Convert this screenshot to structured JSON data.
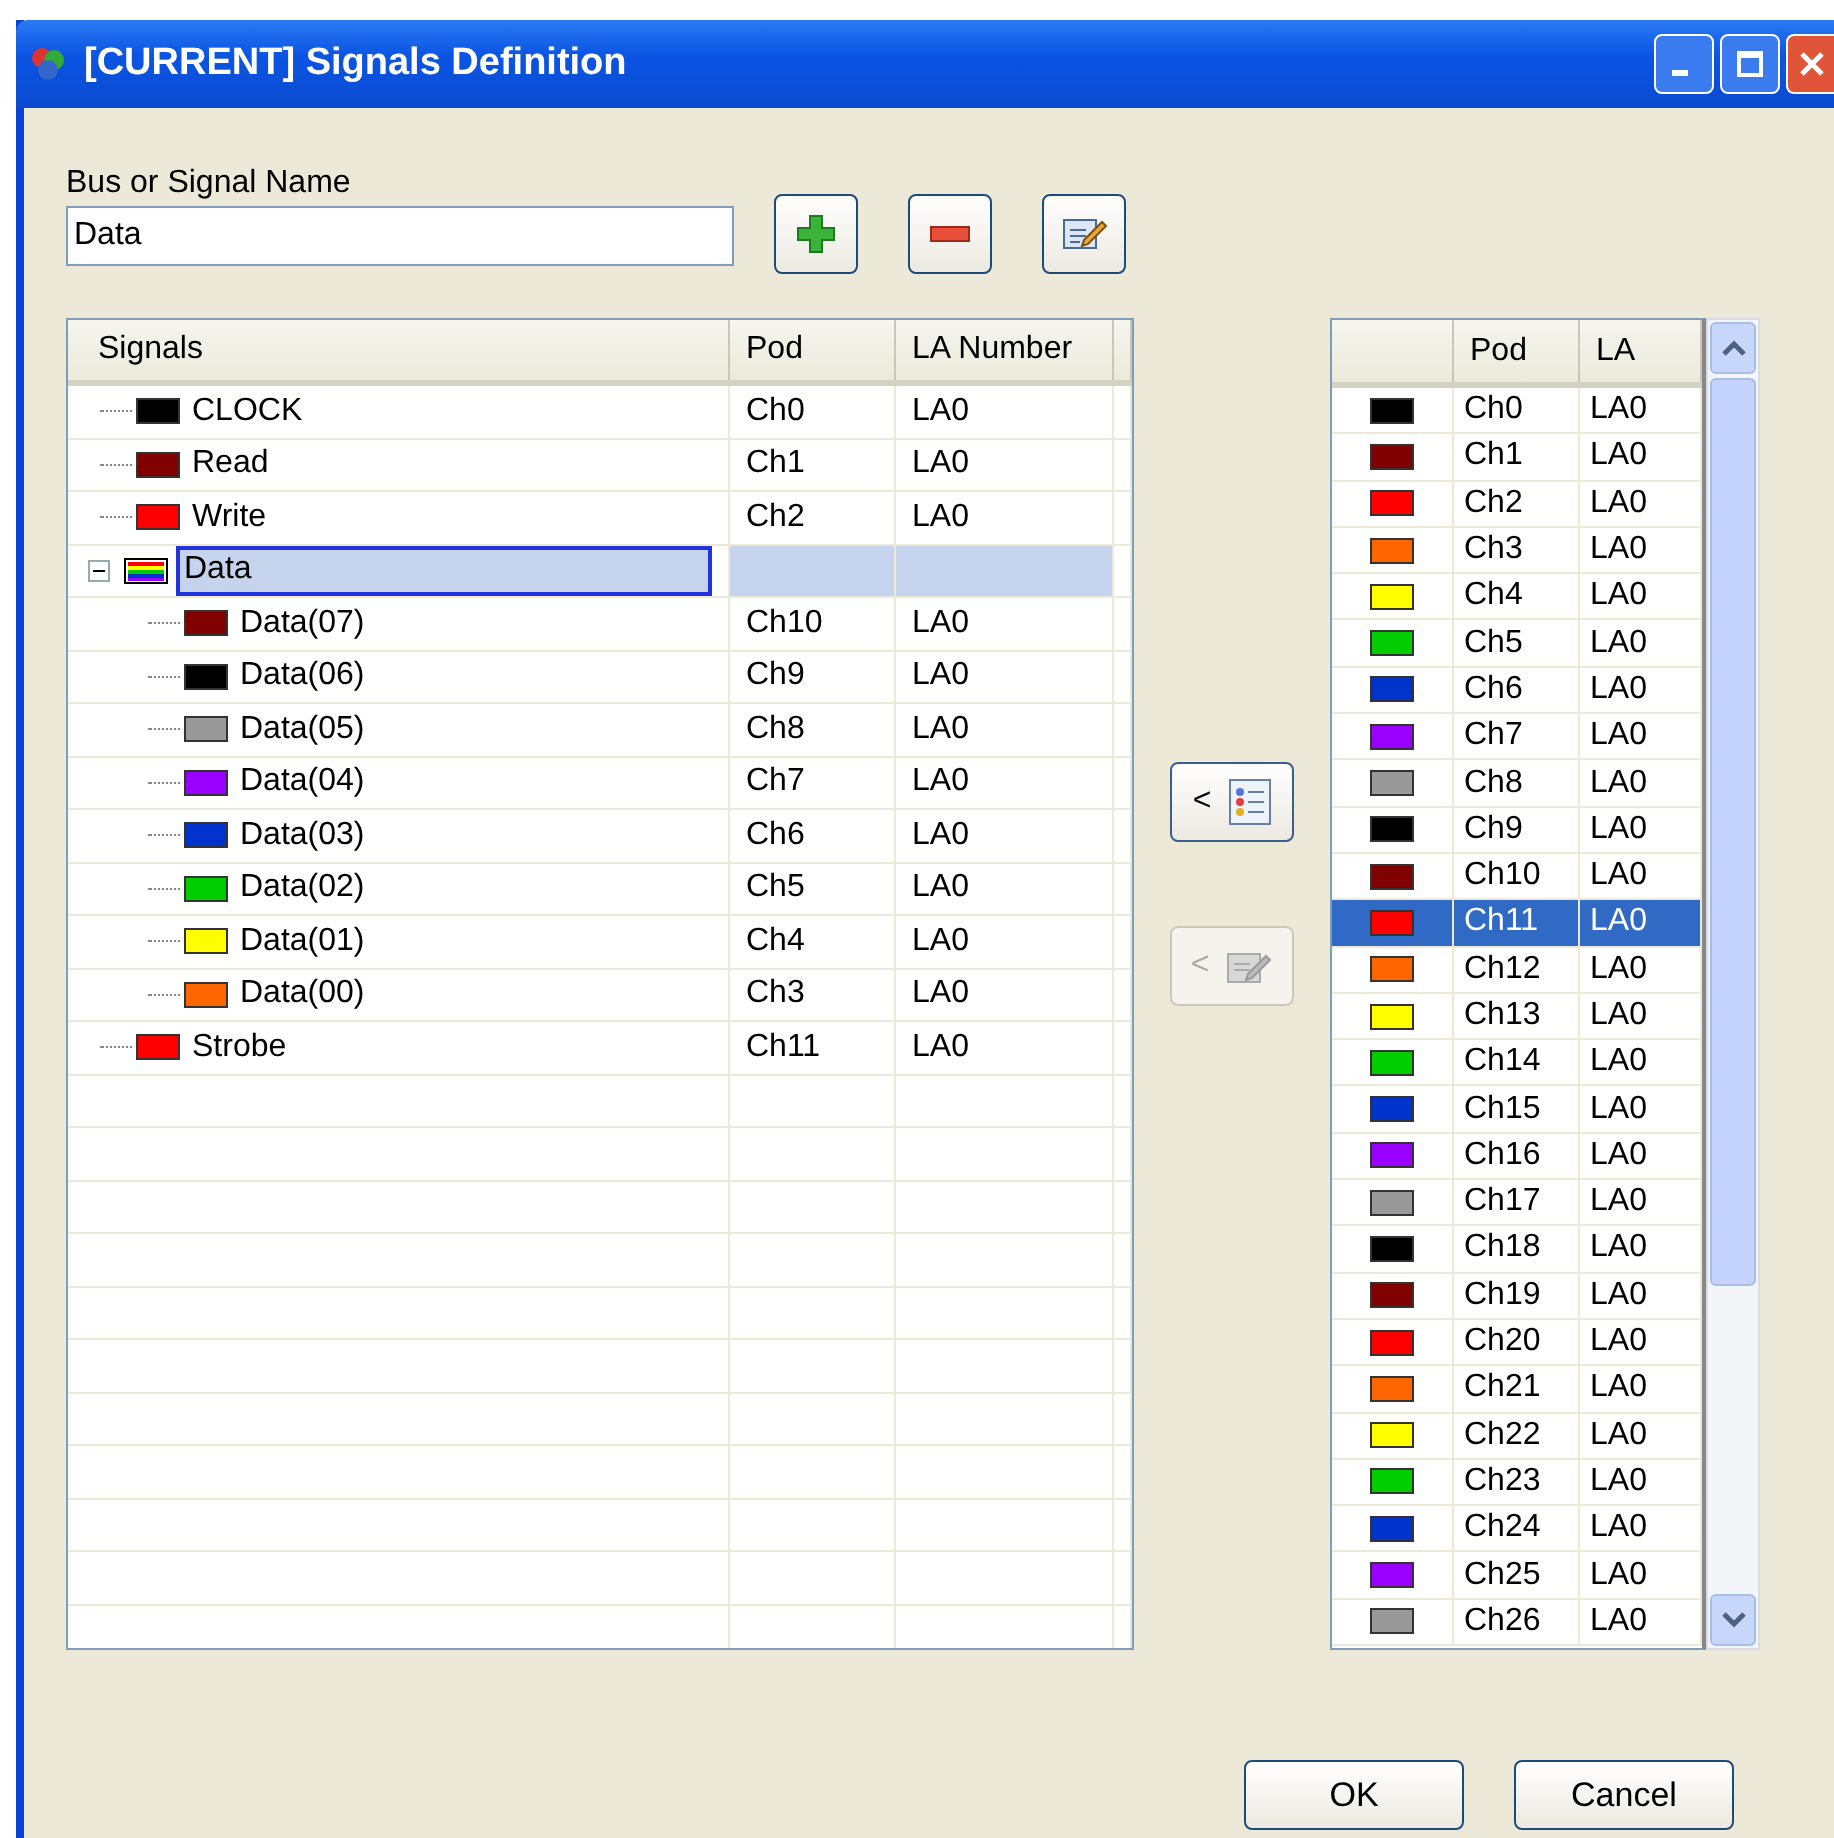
{
  "window": {
    "title": "[CURRENT] Signals Definition"
  },
  "name_field": {
    "label": "Bus or Signal Name",
    "value": "Data"
  },
  "signals_table": {
    "columns": [
      "Signals",
      "Pod",
      "LA Number"
    ],
    "rows": [
      {
        "kind": "signal",
        "name": "CLOCK",
        "color": "#000000",
        "pod": "Ch0",
        "la": "LA0",
        "selected": false
      },
      {
        "kind": "signal",
        "name": "Read",
        "color": "#800000",
        "pod": "Ch1",
        "la": "LA0",
        "selected": false
      },
      {
        "kind": "signal",
        "name": "Write",
        "color": "#ff0000",
        "pod": "Ch2",
        "la": "LA0",
        "selected": false
      },
      {
        "kind": "bus",
        "name": "Data",
        "selected": true,
        "expanded": true,
        "children": [
          {
            "kind": "signal",
            "name": "Data(07)",
            "color": "#800000",
            "pod": "Ch10",
            "la": "LA0",
            "selected": false
          },
          {
            "kind": "signal",
            "name": "Data(06)",
            "color": "#000000",
            "pod": "Ch9",
            "la": "LA0",
            "selected": false
          },
          {
            "kind": "signal",
            "name": "Data(05)",
            "color": "#999999",
            "pod": "Ch8",
            "la": "LA0",
            "selected": false
          },
          {
            "kind": "signal",
            "name": "Data(04)",
            "color": "#9900ff",
            "pod": "Ch7",
            "la": "LA0",
            "selected": false
          },
          {
            "kind": "signal",
            "name": "Data(03)",
            "color": "#0033cc",
            "pod": "Ch6",
            "la": "LA0",
            "selected": false
          },
          {
            "kind": "signal",
            "name": "Data(02)",
            "color": "#00cc00",
            "pod": "Ch5",
            "la": "LA0",
            "selected": false
          },
          {
            "kind": "signal",
            "name": "Data(01)",
            "color": "#ffff00",
            "pod": "Ch4",
            "la": "LA0",
            "selected": false
          },
          {
            "kind": "signal",
            "name": "Data(00)",
            "color": "#ff6600",
            "pod": "Ch3",
            "la": "LA0",
            "selected": false
          }
        ]
      },
      {
        "kind": "signal",
        "name": "Strobe",
        "color": "#ff0000",
        "pod": "Ch11",
        "la": "LA0",
        "selected": false
      }
    ]
  },
  "channel_list": {
    "columns": [
      "Pod",
      "LA"
    ],
    "rows": [
      {
        "color": "#000000",
        "pod": "Ch0",
        "la": "LA0",
        "selected": false
      },
      {
        "color": "#800000",
        "pod": "Ch1",
        "la": "LA0",
        "selected": false
      },
      {
        "color": "#ff0000",
        "pod": "Ch2",
        "la": "LA0",
        "selected": false
      },
      {
        "color": "#ff6600",
        "pod": "Ch3",
        "la": "LA0",
        "selected": false
      },
      {
        "color": "#ffff00",
        "pod": "Ch4",
        "la": "LA0",
        "selected": false
      },
      {
        "color": "#00cc00",
        "pod": "Ch5",
        "la": "LA0",
        "selected": false
      },
      {
        "color": "#0033cc",
        "pod": "Ch6",
        "la": "LA0",
        "selected": false
      },
      {
        "color": "#9900ff",
        "pod": "Ch7",
        "la": "LA0",
        "selected": false
      },
      {
        "color": "#999999",
        "pod": "Ch8",
        "la": "LA0",
        "selected": false
      },
      {
        "color": "#000000",
        "pod": "Ch9",
        "la": "LA0",
        "selected": false
      },
      {
        "color": "#800000",
        "pod": "Ch10",
        "la": "LA0",
        "selected": false
      },
      {
        "color": "#ff0000",
        "pod": "Ch11",
        "la": "LA0",
        "selected": true
      },
      {
        "color": "#ff6600",
        "pod": "Ch12",
        "la": "LA0",
        "selected": false
      },
      {
        "color": "#ffff00",
        "pod": "Ch13",
        "la": "LA0",
        "selected": false
      },
      {
        "color": "#00cc00",
        "pod": "Ch14",
        "la": "LA0",
        "selected": false
      },
      {
        "color": "#0033cc",
        "pod": "Ch15",
        "la": "LA0",
        "selected": false
      },
      {
        "color": "#9900ff",
        "pod": "Ch16",
        "la": "LA0",
        "selected": false
      },
      {
        "color": "#999999",
        "pod": "Ch17",
        "la": "LA0",
        "selected": false
      },
      {
        "color": "#000000",
        "pod": "Ch18",
        "la": "LA0",
        "selected": false
      },
      {
        "color": "#800000",
        "pod": "Ch19",
        "la": "LA0",
        "selected": false
      },
      {
        "color": "#ff0000",
        "pod": "Ch20",
        "la": "LA0",
        "selected": false
      },
      {
        "color": "#ff6600",
        "pod": "Ch21",
        "la": "LA0",
        "selected": false
      },
      {
        "color": "#ffff00",
        "pod": "Ch22",
        "la": "LA0",
        "selected": false
      },
      {
        "color": "#00cc00",
        "pod": "Ch23",
        "la": "LA0",
        "selected": false
      },
      {
        "color": "#0033cc",
        "pod": "Ch24",
        "la": "LA0",
        "selected": false
      },
      {
        "color": "#9900ff",
        "pod": "Ch25",
        "la": "LA0",
        "selected": false
      },
      {
        "color": "#999999",
        "pod": "Ch26",
        "la": "LA0",
        "selected": false
      }
    ]
  },
  "assign_buttons": [
    {
      "label": "<",
      "disabled": false
    },
    {
      "label": "<",
      "disabled": true
    }
  ],
  "buttons": [
    "OK",
    "Cancel"
  ]
}
